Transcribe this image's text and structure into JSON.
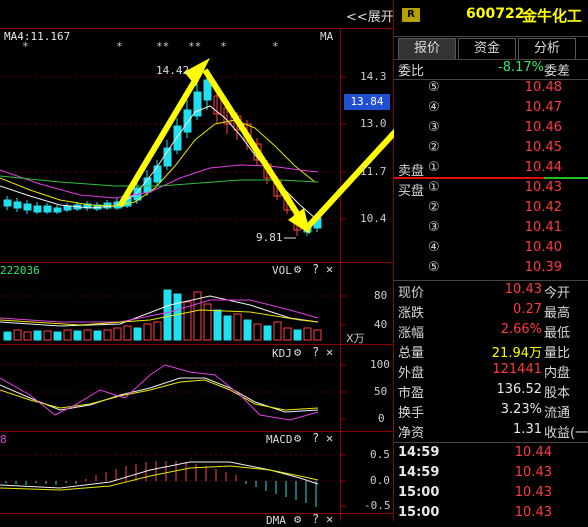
{
  "header": {
    "expand_label": "<<展开",
    "badge": "R",
    "code": "600722",
    "name": "金牛化工"
  },
  "chart": {
    "ma_label": "MA4:11.167",
    "ma_right": "MA",
    "peak_label": "14.42",
    "low_label": "9.81",
    "stars": [
      "*",
      "*",
      "**",
      "**",
      "*",
      "*"
    ],
    "price_ticks": [
      "14.3",
      "13.0",
      "11.7",
      "10.4"
    ],
    "current_price_tag": "13.84",
    "vol_value": "222036",
    "vol_label": "VOL",
    "vol_ticks": [
      "80",
      "40"
    ],
    "vol_unit": "X万",
    "kdj_label": "KDJ",
    "kdj_ticks": [
      "100",
      "50",
      "0"
    ],
    "macd_label": "MACD",
    "macd_left": "8",
    "macd_ticks": [
      "0.5",
      "0.0",
      "-0.5"
    ],
    "bottom_label": "DMA"
  },
  "panel": {
    "tabs": [
      "报价",
      "资金",
      "分析"
    ],
    "weibi_label": "委比",
    "weibi_value": "-8.17%",
    "weicha_label": "委差",
    "sell_label": "卖盘",
    "buy_label": "买盘",
    "sell_levels": [
      {
        "n": "⑤",
        "price": "10.48"
      },
      {
        "n": "④",
        "price": "10.47"
      },
      {
        "n": "③",
        "price": "10.46"
      },
      {
        "n": "②",
        "price": "10.45"
      },
      {
        "n": "①",
        "price": "10.44"
      }
    ],
    "buy_levels": [
      {
        "n": "①",
        "price": "10.43"
      },
      {
        "n": "②",
        "price": "10.42"
      },
      {
        "n": "③",
        "price": "10.41"
      },
      {
        "n": "④",
        "price": "10.40"
      },
      {
        "n": "⑤",
        "price": "10.39"
      }
    ],
    "stats": [
      {
        "label": "现价",
        "value": "10.43",
        "label2": "今开",
        "color": "red"
      },
      {
        "label": "涨跌",
        "value": "0.27",
        "label2": "最高",
        "color": "red"
      },
      {
        "label": "涨幅",
        "value": "2.66%",
        "label2": "最低",
        "color": "red"
      },
      {
        "label": "总量",
        "value": "21.94万",
        "label2": "量比",
        "color": "yellow"
      },
      {
        "label": "外盘",
        "value": "121441",
        "label2": "内盘",
        "color": "red"
      },
      {
        "label": "市盈",
        "value": "136.52",
        "label2": "股本",
        "color": "white"
      },
      {
        "label": "换手",
        "value": "3.23%",
        "label2": "流通",
        "color": "white"
      },
      {
        "label": "净资",
        "value": "1.31",
        "label2": "收益(一",
        "color": "white"
      }
    ],
    "ticks": [
      {
        "time": "14:59",
        "price": "10.44"
      },
      {
        "time": "14:59",
        "price": "10.43"
      },
      {
        "time": "15:00",
        "price": "10.43"
      },
      {
        "time": "15:00",
        "price": "10.43"
      }
    ]
  }
}
